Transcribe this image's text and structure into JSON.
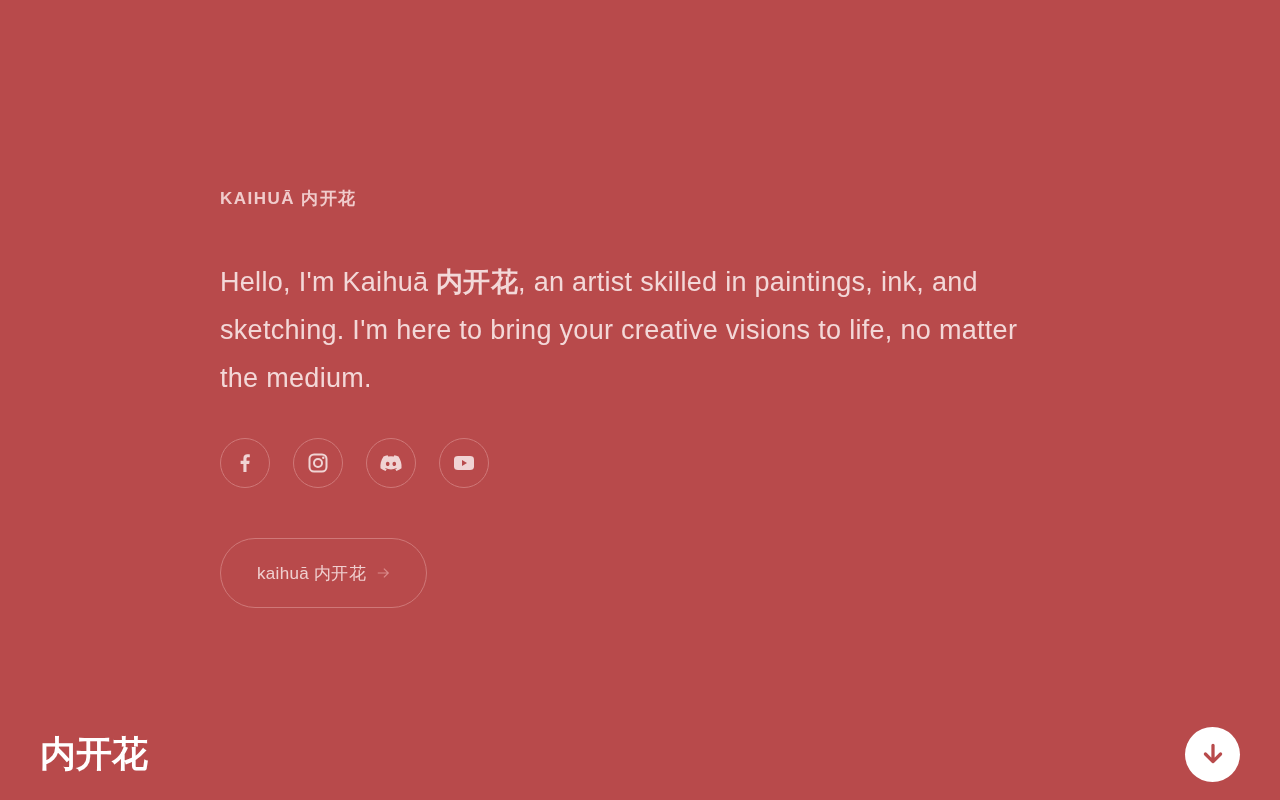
{
  "eyebrow": "KAIHUĀ 内开花",
  "intro": "Hello, I'm Kaihuā **内开花**, an artist skilled in paintings, ink, and sketching. I'm here to bring your creative visions to life, no matter the medium.",
  "social_links": [
    {
      "kind": "facebook"
    },
    {
      "kind": "instagram"
    },
    {
      "kind": "discord"
    },
    {
      "kind": "youtube"
    }
  ],
  "cta_button": {
    "label": "kaihuā 内开花"
  },
  "footer": {
    "logo": "内开花"
  }
}
